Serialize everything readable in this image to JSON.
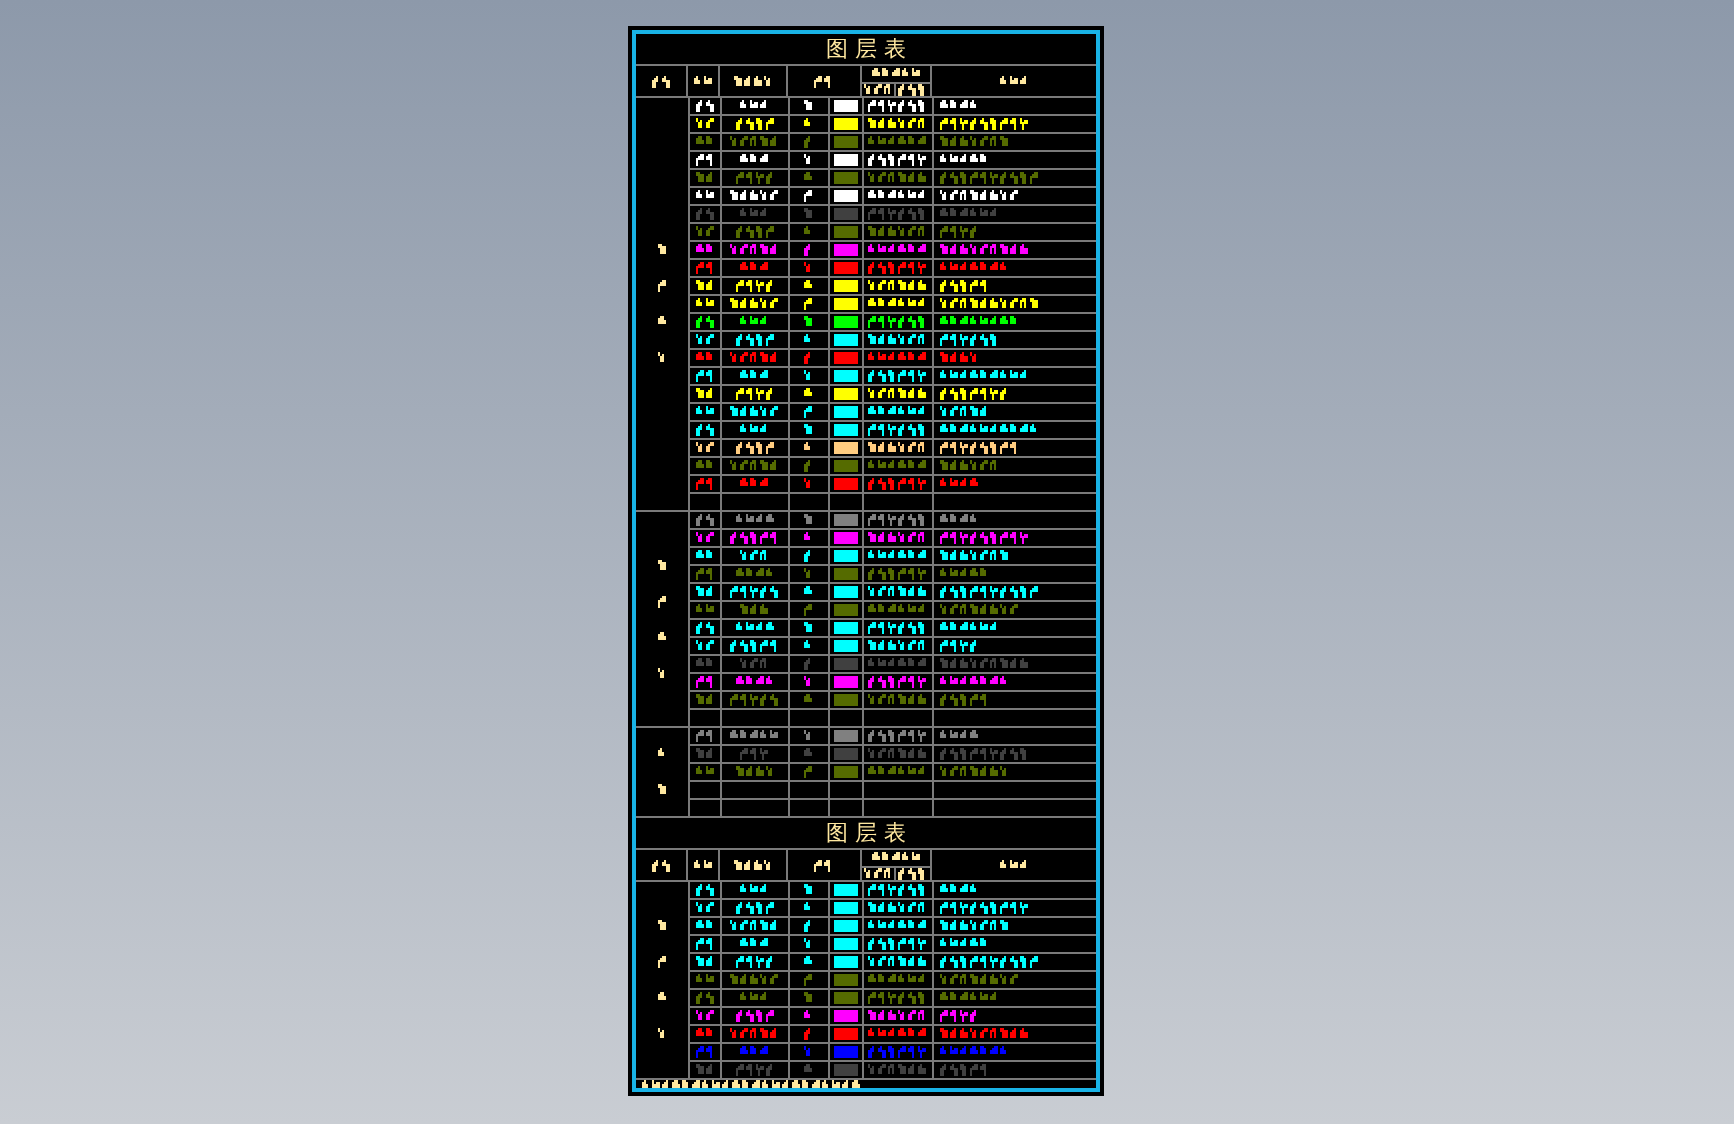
{
  "tables": [
    {
      "title": "图 层 表",
      "sections": [
        {
          "rows": [
            {
              "kind": "layer",
              "color": "#ffffff"
            },
            {
              "kind": "layer",
              "color": "#ffff00"
            },
            {
              "kind": "layer",
              "color": "#556b00"
            },
            {
              "kind": "layer",
              "color": "#ffffff"
            },
            {
              "kind": "layer",
              "color": "#556b00"
            },
            {
              "kind": "layer",
              "color": "#ffffff"
            },
            {
              "kind": "layer",
              "color": "#404040"
            },
            {
              "kind": "layer",
              "color": "#556b00"
            },
            {
              "kind": "layer",
              "color": "#ff00ff"
            },
            {
              "kind": "layer",
              "color": "#ff0000"
            },
            {
              "kind": "layer",
              "color": "#ffff00"
            },
            {
              "kind": "layer",
              "color": "#ffff00"
            },
            {
              "kind": "layer",
              "color": "#00ff00"
            },
            {
              "kind": "layer",
              "color": "#00ffff"
            },
            {
              "kind": "layer",
              "color": "#ff0000"
            },
            {
              "kind": "layer",
              "color": "#00ffff"
            },
            {
              "kind": "layer",
              "color": "#ffff00"
            },
            {
              "kind": "layer",
              "color": "#00ffff"
            },
            {
              "kind": "layer",
              "color": "#00ffff"
            },
            {
              "kind": "layer",
              "color": "#ffcc80"
            },
            {
              "kind": "layer",
              "color": "#556b00"
            },
            {
              "kind": "layer",
              "color": "#ff0000"
            },
            {
              "kind": "empty"
            }
          ]
        },
        {
          "rows": [
            {
              "kind": "layer",
              "color": "#808080"
            },
            {
              "kind": "layer",
              "color": "#ff00ff"
            },
            {
              "kind": "layer",
              "color": "#00ffff"
            },
            {
              "kind": "layer",
              "color": "#556b00"
            },
            {
              "kind": "layer",
              "color": "#00ffff"
            },
            {
              "kind": "layer",
              "color": "#556b00"
            },
            {
              "kind": "layer",
              "color": "#00ffff"
            },
            {
              "kind": "layer",
              "color": "#00ffff"
            },
            {
              "kind": "layer",
              "color": "#404040"
            },
            {
              "kind": "layer",
              "color": "#ff00ff"
            },
            {
              "kind": "layer",
              "color": "#556b00"
            },
            {
              "kind": "empty"
            }
          ]
        },
        {
          "rows": [
            {
              "kind": "layer",
              "color": "#808080"
            },
            {
              "kind": "layer",
              "color": "#404040"
            },
            {
              "kind": "layer",
              "color": "#556b00"
            },
            {
              "kind": "empty"
            },
            {
              "kind": "empty"
            }
          ]
        }
      ]
    },
    {
      "title": "图 层 表",
      "sections": [
        {
          "rows": [
            {
              "kind": "layer",
              "color": "#00ffff"
            },
            {
              "kind": "layer",
              "color": "#00ffff"
            },
            {
              "kind": "layer",
              "color": "#00ffff"
            },
            {
              "kind": "layer",
              "color": "#00ffff"
            },
            {
              "kind": "layer",
              "color": "#00ffff"
            },
            {
              "kind": "layer",
              "color": "#556b00"
            },
            {
              "kind": "layer",
              "color": "#556b00"
            },
            {
              "kind": "layer",
              "color": "#ff00ff"
            },
            {
              "kind": "layer",
              "color": "#ff0000"
            },
            {
              "kind": "layer",
              "color": "#0000ff"
            },
            {
              "kind": "layer",
              "color": "#404040"
            }
          ]
        }
      ]
    }
  ]
}
